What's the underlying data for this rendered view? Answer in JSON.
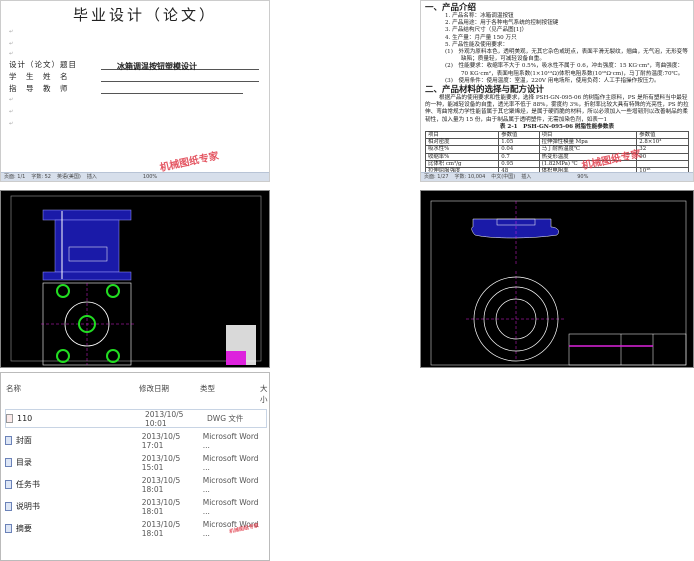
{
  "cover_doc": {
    "title": "毕业设计（论文）",
    "fields": [
      {
        "label": "设计（论文）题目",
        "value": "冰箱调温按钮塑模设计"
      },
      {
        "label": "学　生　姓　名",
        "value": ""
      },
      {
        "label": "指　导　教　师",
        "value": ""
      }
    ],
    "status": [
      "页面: 1/1",
      "字数: 52",
      "英语(美国)",
      "插入",
      "100%"
    ],
    "watermark": "机械图纸专家"
  },
  "spec_doc": {
    "h1": "一、产品介绍",
    "items": [
      "1. 产品名称：冰箱调温按钮",
      "2. 产品用途：用于各种电气系统的控制按钮键",
      "3. 产品结构尺寸（见产品图[1]）",
      "4. 生产量：月产量 150 万只",
      "5. 产品性能及使用要求："
    ],
    "subs": [
      "(1)　外观为原料本色，透明美观，无其它杂色或斑点，表面平滑无裂纹，翘曲，无气泡，无形变等缺陷；质量轻，可减轻设备自重。",
      "(2)　性能要求：收缩率不大于 0.5%，吸水性不属于 0.6，冲击强度：15 KG·cm²，弯曲强度：70 KG·cm²，表面电阻系数(1×10¹²Ω)体积电阻系数(10¹⁶Ω·cm)，马丁耐热温度:70℃。",
      "(3)　使用条件：使用温度：室温，220V 用电场所，使用负荷：人工手指操作按压力。"
    ],
    "h2": "二、产品材料的选择与配方设计",
    "para": "根据产品的使用要求和性能要求，选择 PSH-GN-095-06 的树脂作主原料，PS 是所有塑料当中最轻的一种，能减轻设备的自重，透光率不低于 88%，雾度约 3%，折射率比较大具有特殊的光亮性，PS 的拉伸、弯曲常规力学性能皆属于其它聚烯烃，是属于硬而脆的材料，所以必须加入一些增韧剂以改善制品的柔韧性，加入量为 15 份，由于制品属于透明塑件，无需加染色剂，如表一1",
    "table_caption": "表 2-1　PSH-GN-095-06 树脂性能参数表",
    "table": [
      [
        "项目",
        "参数值",
        "项目",
        "参数值"
      ],
      [
        "相对密度",
        "1.05",
        "拉伸弹性模量 Mpa",
        "2.8×10³"
      ],
      [
        "吸水性%",
        "0.04",
        "马丁耐热温度℃",
        "32"
      ],
      [
        "收缩率%",
        "0.7",
        "热变形温度",
        "90"
      ],
      [
        "比体积 cm³/g",
        "0.95",
        "(1.82MPa) ℃",
        ""
      ],
      [
        "拉伸屈服强度",
        "48",
        "体积电阻率",
        "10¹⁶"
      ]
    ],
    "status": [
      "页面: 1/27",
      "字数: 10,004",
      "中文(中国)",
      "插入",
      "90%"
    ],
    "watermark": "机械图纸专家"
  },
  "file_list": {
    "headers": [
      "名称",
      "修改日期",
      "类型",
      "大小"
    ],
    "rows": [
      {
        "name": "110",
        "date": "2013/10/5 10:01",
        "type": "DWG 文件",
        "icon": "dwg-file-icon"
      },
      {
        "name": "封面",
        "date": "2013/10/5 17:01",
        "type": "Microsoft Word ...",
        "icon": "word-file-icon"
      },
      {
        "name": "目录",
        "date": "2013/10/5 15:01",
        "type": "Microsoft Word ...",
        "icon": "word-file-icon"
      },
      {
        "name": "任务书",
        "date": "2013/10/5 18:01",
        "type": "Microsoft Word ...",
        "icon": "word-file-icon"
      },
      {
        "name": "说明书",
        "date": "2013/10/5 18:01",
        "type": "Microsoft Word ...",
        "icon": "word-file-icon"
      },
      {
        "name": "摘要",
        "date": "2013/10/5 18:01",
        "type": "Microsoft Word ...",
        "icon": "word-file-icon"
      }
    ],
    "watermark": "机械图纸专家"
  },
  "colors": {
    "cad_bg": "#000000",
    "cad_blue": "#1a1aa8",
    "cad_green": "#22dd22",
    "cad_magenta": "#dd22dd",
    "watermark": "#e03c4a"
  }
}
